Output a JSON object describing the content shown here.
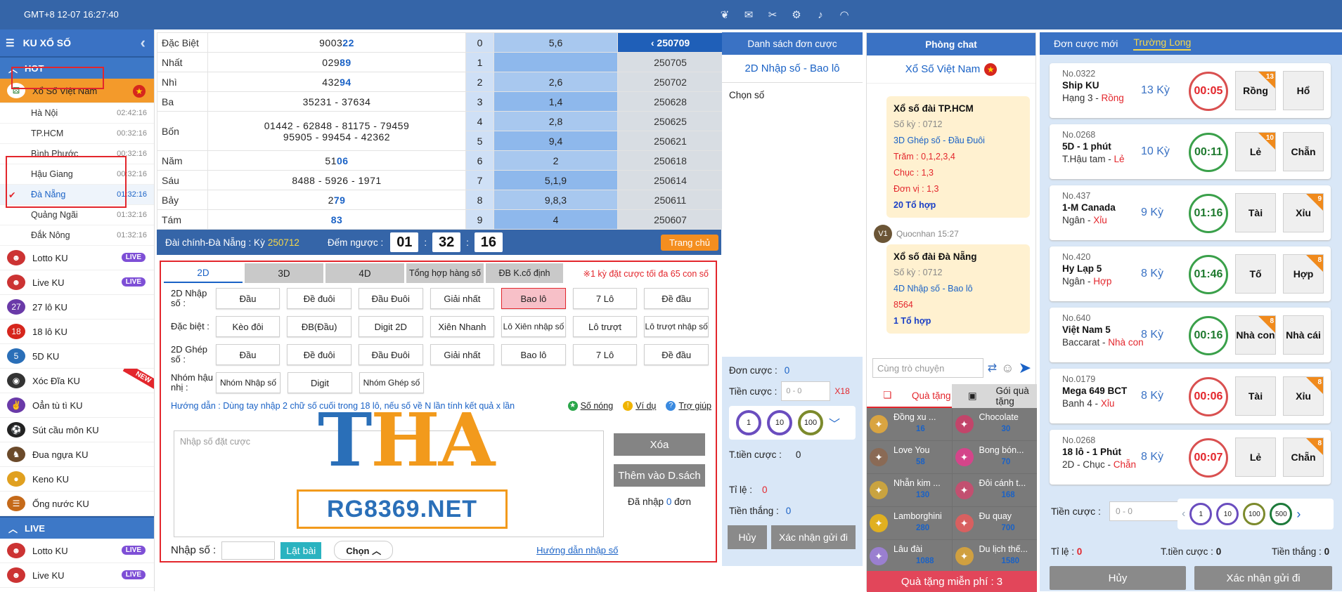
{
  "topbar": {
    "time": "GMT+8 12-07 16:27:40",
    "icons": [
      "gift-icon",
      "mail-icon",
      "tools-icon",
      "gear-icon",
      "volume-icon",
      "wifi-icon"
    ]
  },
  "sidebar": {
    "title": "KU XỔ SỐ",
    "hot_label": "HOT",
    "live_label": "LIVE",
    "active_game": "Xổ Số Việt Nam",
    "regions": [
      {
        "name": "Hà Nội",
        "time": "02:42:16"
      },
      {
        "name": "TP.HCM",
        "time": "00:32:16"
      },
      {
        "name": "Bình Phước",
        "time": "00:32:16"
      },
      {
        "name": "Hậu Giang",
        "time": "00:32:16"
      },
      {
        "name": "Đà Nẵng",
        "time": "01:32:16"
      },
      {
        "name": "Quảng Ngãi",
        "time": "01:32:16"
      },
      {
        "name": "Đắk Nông",
        "time": "01:32:16"
      }
    ],
    "games": [
      {
        "name": "Lotto KU",
        "badge": "LIVE"
      },
      {
        "name": "Live KU",
        "badge": "LIVE"
      },
      {
        "name": "27 lô KU",
        "badge": ""
      },
      {
        "name": "18 lô KU",
        "badge": ""
      },
      {
        "name": "5D KU",
        "badge": ""
      },
      {
        "name": "Xóc Đĩa KU",
        "badge": "NEW"
      },
      {
        "name": "Oẳn tù tì KU",
        "badge": ""
      },
      {
        "name": "Sút cầu môn KU",
        "badge": ""
      },
      {
        "name": "Đua ngựa KU",
        "badge": ""
      },
      {
        "name": "Keno KU",
        "badge": ""
      },
      {
        "name": "Ống nước KU",
        "badge": ""
      }
    ],
    "live_games": [
      {
        "name": "Lotto KU",
        "badge": "LIVE"
      },
      {
        "name": "Live KU",
        "badge": "LIVE"
      }
    ]
  },
  "results": {
    "prizes": [
      {
        "name": "Đặc Biệt",
        "pre": "9003",
        "hl": "22"
      },
      {
        "name": "Nhất",
        "pre": "029",
        "hl": "89"
      },
      {
        "name": "Nhì",
        "pre": "432",
        "hl": "94"
      },
      {
        "name": "Ba",
        "line": "35231 - 37634"
      },
      {
        "name": "Bốn",
        "line1": "01442 - 62848 - 81175 - 79459",
        "line2": "95905 - 99454 - 42362"
      },
      {
        "name": "Năm",
        "pre": "51",
        "hl": "06"
      },
      {
        "name": "Sáu",
        "line": "8488 - 5926 - 1971"
      },
      {
        "name": "Bảy",
        "pre": "2",
        "hl": "79"
      },
      {
        "name": "Tám",
        "pre": "",
        "hl": "83"
      }
    ],
    "digits": [
      {
        "d": "0",
        "v": "5,6"
      },
      {
        "d": "1",
        "v": ""
      },
      {
        "d": "2",
        "v": "2,6"
      },
      {
        "d": "3",
        "v": "1,4"
      },
      {
        "d": "4",
        "v": "2,8"
      },
      {
        "d": "5",
        "v": "9,4"
      },
      {
        "d": "6",
        "v": "2"
      },
      {
        "d": "7",
        "v": "5,1,9"
      },
      {
        "d": "8",
        "v": "9,8,3"
      },
      {
        "d": "9",
        "v": "4"
      }
    ],
    "rounds": [
      "250709",
      "250705",
      "250702",
      "250628",
      "250625",
      "250621",
      "250618",
      "250614",
      "250611",
      "250607"
    ]
  },
  "drawbar": {
    "label": "Đài chính-Đà Nẵng : Kỳ",
    "ky": "250712",
    "countdown_label": "Đếm ngược :",
    "h": "01",
    "m": "32",
    "s": "16",
    "home_btn": "Trang chủ"
  },
  "betpanel": {
    "tabs": [
      "2D",
      "3D",
      "4D",
      "Tổng hợp hàng số",
      "ĐB K.cố định"
    ],
    "note": "※1 kỳ đặt cược tối đa 65 con số",
    "rows": [
      {
        "label": "2D Nhập số :",
        "buttons": [
          "Đầu",
          "Đề đuôi",
          "Đầu Đuôi",
          "Giải nhất",
          "Bao lô",
          "7 Lô",
          "Đề đầu"
        ]
      },
      {
        "label": "Đặc biệt :",
        "buttons": [
          "Kèo đôi",
          "ĐB(Đầu)",
          "Digit 2D",
          "Xiên Nhanh",
          "Lô Xiên nhập số",
          "Lô trượt",
          "Lô trượt nhập số"
        ]
      },
      {
        "label": "2D Ghép số :",
        "buttons": [
          "Đầu",
          "Đề đuôi",
          "Đầu Đuôi",
          "Giải nhất",
          "Bao lô",
          "7 Lô",
          "Đề đầu"
        ]
      },
      {
        "label": "Nhóm hậu nhị :",
        "buttons": [
          "Nhóm Nhập số",
          "Digit",
          "Nhóm Ghép số"
        ]
      }
    ],
    "guide": "Hướng dẫn : Dùng tay nhập 2 chữ số cuối trong 18 lô, nếu số về N lần tính kết quả x lần",
    "links": [
      "Số nóng",
      "Ví dụ",
      "Trợ giúp"
    ],
    "entry_placeholder": "Nhập số đặt cược",
    "btn_clear": "Xóa",
    "btn_add": "Thêm vào D.sách",
    "counted_pre": "Đã nhập",
    "counted_num": "0",
    "counted_post": "đơn",
    "input_label": "Nhập số :",
    "btn_flip": "Lật bài",
    "btn_choose": "Chọn",
    "help_link": "Hướng dẫn nhập số"
  },
  "watermark": {
    "big": "THA",
    "site": "RG8369.NET"
  },
  "betlist": {
    "title": "Danh sách đơn cược",
    "subtitle": "2D Nhập số - Bao lô",
    "choose": "Chọn số",
    "don_cuoc_label": "Đơn cược :",
    "don_cuoc": "0",
    "tien_cuoc_label": "Tiền cược :",
    "tien_cuoc_ph": "0 - 0",
    "mult": "X18",
    "chips": [
      "1",
      "10",
      "100"
    ],
    "total_label": "T.tiền cược :",
    "total": "0",
    "rate_label": "Tỉ lệ :",
    "rate": "0",
    "win_label": "Tiền thắng :",
    "win": "0",
    "btn_cancel": "Hủy",
    "btn_confirm": "Xác nhận gửi đi"
  },
  "chat": {
    "title": "Phòng chat",
    "room": "Xổ Số Việt Nam",
    "messages": [
      {
        "title": "Xổ số đài TP.HCM",
        "ky": "Số kỳ : 0712",
        "type": "3D Ghép số - Đầu Đuôi",
        "lines": [
          "Trăm : 0,1,2,3,4",
          "Chục : 1,3",
          "Đơn vị : 1,3"
        ],
        "combo": "20 Tổ hợp"
      },
      {
        "sender": "Quocnhan 15:27",
        "title": "Xổ số đài Đà Nẵng",
        "ky": "Số kỳ : 0712",
        "type": "4D Nhập số - Bao lô",
        "lines": [
          "8564"
        ],
        "combo": "1 Tổ hợp"
      }
    ],
    "avatar": "V1",
    "input_ph": "Cùng trò chuyện",
    "gift_tab": "Quà tặng",
    "gift_pack_tab": "Gói quà tặng",
    "gifts": [
      {
        "name": "Đồng xu ...",
        "price": "16",
        "icon": "coin-icon",
        "color": "#d9a441"
      },
      {
        "name": "Chocolate",
        "price": "30",
        "icon": "chocolate-icon",
        "color": "#c2456a"
      },
      {
        "name": "Love You",
        "price": "58",
        "icon": "heart-icon",
        "color": "#8a6a55"
      },
      {
        "name": "Bong bón...",
        "price": "70",
        "icon": "balloon-icon",
        "color": "#d4458a"
      },
      {
        "name": "Nhẫn kim ...",
        "price": "130",
        "icon": "ring-icon",
        "color": "#c9a340"
      },
      {
        "name": "Đôi cánh t...",
        "price": "168",
        "icon": "wings-icon",
        "color": "#c25070"
      },
      {
        "name": "Lamborghini",
        "price": "280",
        "icon": "car-icon",
        "color": "#e0b020"
      },
      {
        "name": "Đu quay",
        "price": "700",
        "icon": "ferris-icon",
        "color": "#d86060"
      },
      {
        "name": "Lâu đài",
        "price": "1088",
        "icon": "castle-icon",
        "color": "#9a7fd0"
      },
      {
        "name": "Du lịch thế...",
        "price": "1580",
        "icon": "plane-icon",
        "color": "#d0a040"
      }
    ],
    "free_gift": "Quà tặng miễn phí : 3"
  },
  "rpanel": {
    "tab1": "Đơn cược mới",
    "tab2": "Trường Long",
    "cards": [
      {
        "no": "No.0322",
        "game": "Ship KU",
        "desc": "Hạng 3 -",
        "hl": "Rồng",
        "ky": "13 Kỳ",
        "time": "00:05",
        "color": "red",
        "o1": "Rồng",
        "o2": "Hổ",
        "cnt": "13",
        "cntOn": "1"
      },
      {
        "no": "No.0268",
        "game": "5D - 1 phút",
        "desc": "T.Hậu tam -",
        "hl": "Lẻ",
        "ky": "10 Kỳ",
        "time": "00:11",
        "color": "grn",
        "o1": "Lẻ",
        "o2": "Chẵn",
        "cnt": "10",
        "cntOn": "1"
      },
      {
        "no": "No.437",
        "game": "1-M Canada",
        "desc": "Ngân -",
        "hl": "Xỉu",
        "ky": "9 Kỳ",
        "time": "01:16",
        "color": "grn",
        "o1": "Tài",
        "o2": "Xỉu",
        "cnt": "9",
        "cntOn": "2"
      },
      {
        "no": "No.420",
        "game": "Hy Lạp 5",
        "desc": "Ngân -",
        "hl": "Hợp",
        "ky": "8 Kỳ",
        "time": "01:46",
        "color": "grn",
        "o1": "Tố",
        "o2": "Hợp",
        "cnt": "8",
        "cntOn": "2"
      },
      {
        "no": "No.640",
        "game": "Việt Nam 5",
        "desc": "Baccarat -",
        "hl": "Nhà con",
        "ky": "8 Kỳ",
        "time": "00:16",
        "color": "grn",
        "o1": "Nhà con",
        "o2": "Nhà cái",
        "cnt": "8",
        "cntOn": "1"
      },
      {
        "no": "No.0179",
        "game": "Mega 649 BCT",
        "desc": "Banh 4 -",
        "hl": "Xỉu",
        "ky": "8 Kỳ",
        "time": "00:06",
        "color": "red",
        "o1": "Tài",
        "o2": "Xỉu",
        "cnt": "8",
        "cntOn": "2"
      },
      {
        "no": "No.0268",
        "game": "18 lô - 1 Phút",
        "desc": "2D - Chục -",
        "hl": "Chẵn",
        "ky": "8 Kỳ",
        "time": "00:07",
        "color": "red",
        "o1": "Lẻ",
        "o2": "Chẵn",
        "cnt": "8",
        "cntOn": "2"
      }
    ],
    "tien_cuoc_label": "Tiền cược :",
    "tien_cuoc_ph": "0 - 0",
    "chips": [
      "1",
      "10",
      "100",
      "500"
    ],
    "rate_label": "Tỉ lệ :",
    "rate": "0",
    "total_label": "T.tiền cược :",
    "total": "0",
    "win_label": "Tiền thắng :",
    "win": "0",
    "btn_cancel": "Hủy",
    "btn_confirm": "Xác nhận gửi đi"
  }
}
